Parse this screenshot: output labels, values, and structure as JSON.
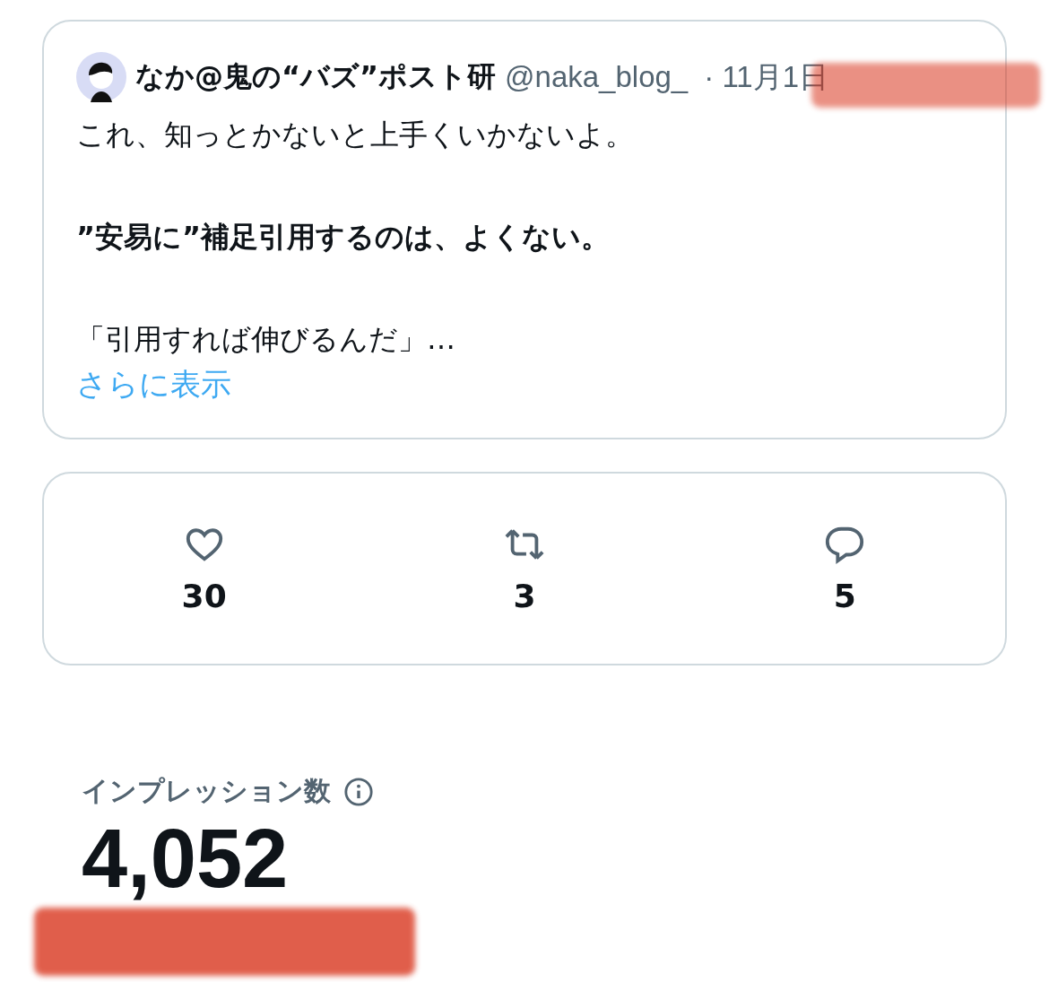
{
  "quoted_post": {
    "author": {
      "name": "なか@鬼の“バズ”ポスト研",
      "handle": "@naka_blog_",
      "date": "· 11月1日"
    },
    "paragraphs": [
      {
        "kind": "plain",
        "text": "これ、知っとかないと上手くいかないよ。"
      },
      {
        "kind": "bold",
        "text": "”安易に”補足引用するのは、よくない。"
      },
      {
        "kind": "plain",
        "text": "「引用すれば伸びるんだ」…"
      }
    ],
    "more_link": "さらに表示"
  },
  "stats": [
    {
      "kind": "like",
      "count": "30"
    },
    {
      "kind": "repost",
      "count": "3"
    },
    {
      "kind": "reply",
      "count": "5"
    }
  ],
  "impressions": {
    "label": "インプレッション数",
    "value": "4,052"
  }
}
